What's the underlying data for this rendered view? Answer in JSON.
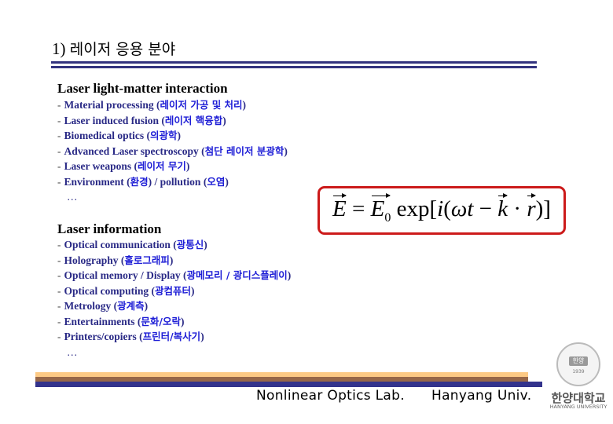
{
  "slide": {
    "title_number": "1)",
    "title_korean": "레이저 응용 분야"
  },
  "section1": {
    "heading": "Laser light-matter interaction",
    "items": [
      {
        "en": "Material processing",
        "ko": "레이저 가공 및 처리"
      },
      {
        "en": "Laser induced fusion",
        "ko": "레이저 핵융합"
      },
      {
        "en": "Biomedical optics",
        "ko": "의광학"
      },
      {
        "en": "Advanced Laser spectroscopy",
        "ko": "첨단 레이저 분광학"
      },
      {
        "en": "Laser weapons",
        "ko": "레이저 무기"
      },
      {
        "en": "Environment",
        "ko": "환경",
        "en2": "pollution",
        "ko2": "오염"
      }
    ],
    "ellipsis": "…"
  },
  "formula": {
    "lhs": "E",
    "equals": "=",
    "amp": "E",
    "amp_sub": "0",
    "exp": "exp[",
    "i": "i",
    "open": "(",
    "omega_t": "ωt",
    "minus": " − ",
    "k": "k",
    "dot": " · ",
    "r": "r",
    "close": ")]"
  },
  "section2": {
    "heading": "Laser information",
    "items": [
      {
        "en": "Optical communication",
        "ko": "광통신"
      },
      {
        "en": "Holography",
        "ko": "홀로그래피"
      },
      {
        "en": "Optical memory / Display",
        "ko": "광메모리 / 광디스플레이"
      },
      {
        "en": "Optical computing",
        "ko": "광컴퓨터"
      },
      {
        "en": "Metrology",
        "ko": "광계측"
      },
      {
        "en": "Entertainments",
        "ko": "문화/오락"
      },
      {
        "en": "Printers/copiers",
        "ko": "프린터/복사기"
      }
    ],
    "ellipsis": "…"
  },
  "footer": {
    "lab": "Nonlinear Optics Lab.",
    "univ": "Hanyang Univ.",
    "logo_ko": "한양대학교",
    "logo_en": "HANYANG UNIVERSITY",
    "logo_seal_text": "한양",
    "logo_year": "1939"
  },
  "colors": {
    "title_rule": "#33337f",
    "list_text": "#2a2a86",
    "korean_text": "#1d1dd6",
    "formula_border": "#cc1a1a",
    "stripe_peach": "#fdca85",
    "stripe_brown": "#976748",
    "stripe_navy": "#33338c"
  }
}
